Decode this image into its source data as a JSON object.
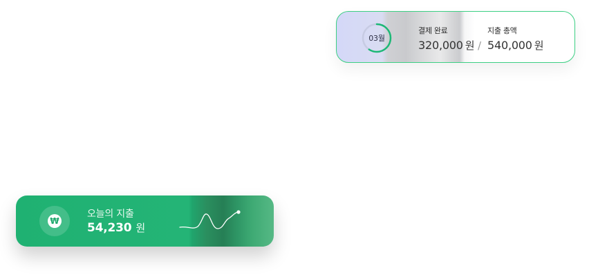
{
  "payment_card": {
    "month": "03월",
    "paid_label": "결제 완료",
    "paid_amount": "320,000",
    "paid_unit": "원",
    "separator": "/",
    "total_label": "지출 총액",
    "total_amount": "540,000",
    "total_unit": "원",
    "progress_fraction": 0.593,
    "ring_color": "#1db876"
  },
  "today_card": {
    "title": "오늘의 지출",
    "amount": "54,230",
    "unit": "원",
    "currency_icon": "won-icon",
    "trend_icon": "sparkline-icon"
  }
}
